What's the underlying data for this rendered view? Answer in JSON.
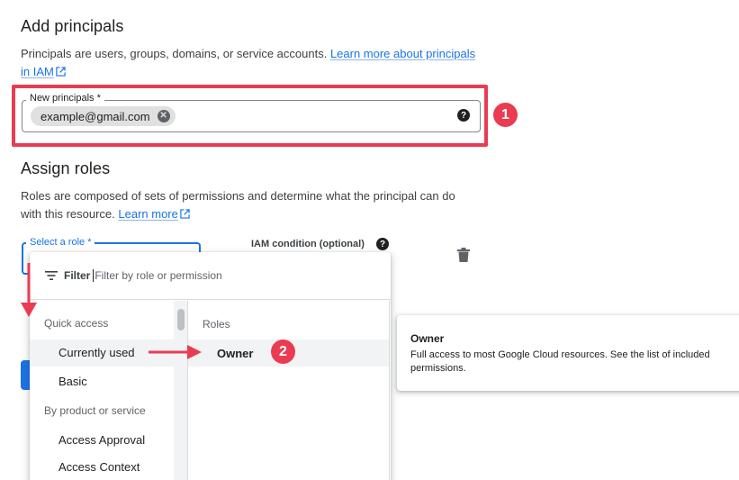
{
  "add_principals": {
    "title": "Add principals",
    "desc_prefix": "Principals are users, groups, domains, or service accounts. ",
    "link_line1": "Learn more about principals",
    "link_line2": "in IAM",
    "field_label": "New principals *",
    "chip_value": "example@gmail.com",
    "help_glyph": "?"
  },
  "assign_roles": {
    "title": "Assign roles",
    "desc_line1": "Roles are composed of sets of permissions and determine what the principal can do",
    "desc_line2_prefix": "with this resource. ",
    "link": "Learn more",
    "select_label": "Select a role *",
    "iam_condition_label": "IAM condition (optional)",
    "help_glyph": "?"
  },
  "dropdown": {
    "filter_label": "Filter",
    "filter_placeholder": "Filter by role or permission",
    "sections": [
      {
        "title": "Quick access",
        "items": [
          "Currently used",
          "Basic"
        ]
      },
      {
        "title": "By product or service",
        "items": [
          "Access Approval",
          "Access Context"
        ]
      }
    ],
    "roles_heading": "Roles",
    "roles": [
      "Owner"
    ]
  },
  "tooltip": {
    "title": "Owner",
    "description": "Full access to most Google Cloud resources. See the list of included permissions."
  },
  "annotations": {
    "badge_1": "1",
    "badge_2": "2"
  },
  "colors": {
    "accent": "#1a73e8",
    "annotation": "#ea3b52",
    "text": "#202124",
    "muted": "#5f6368"
  },
  "icons": [
    "external-link-icon",
    "chip-remove-icon",
    "help-icon",
    "filter-icon",
    "trash-icon"
  ]
}
